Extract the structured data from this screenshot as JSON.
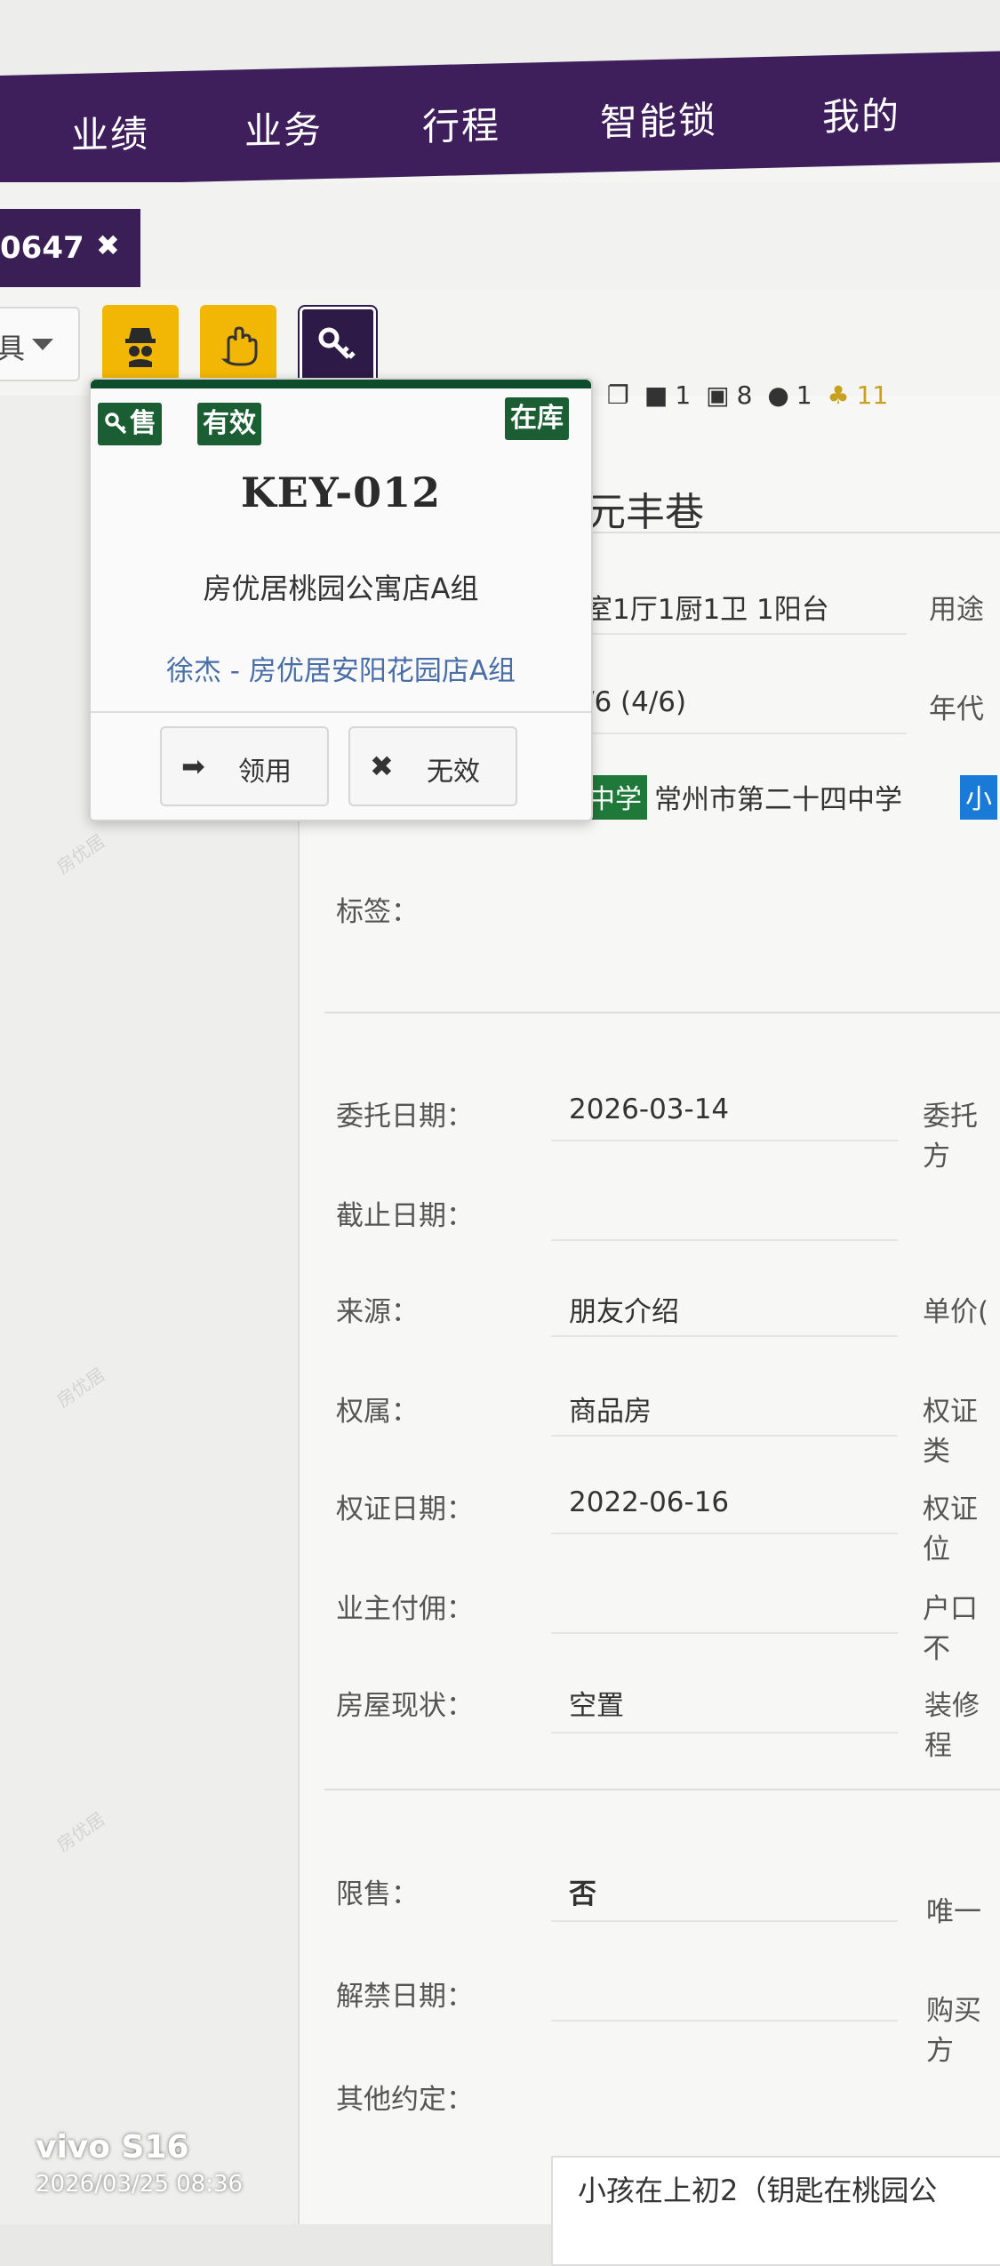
{
  "nav": {
    "items": [
      "业绩",
      "业务",
      "行程",
      "智能锁",
      "我的"
    ]
  },
  "tab": {
    "label": "0647",
    "close": "✖"
  },
  "toolbar": {
    "dropdown_text": "具"
  },
  "icons_row": {
    "video_count": "1",
    "image_count": "8",
    "person_count": "1",
    "gold_count": "11"
  },
  "property": {
    "address_fragment": "元丰巷",
    "layout": "室1厅1厨1卫 1阳台",
    "usage_label": "用途",
    "floor": "/6 (4/6)",
    "year_label": "年代",
    "school_badge": "中学",
    "school_name": "常州市第二十四中学",
    "school_badge2": "小"
  },
  "fields": {
    "tags_label": "标签：",
    "commission_date_label": "委托日期：",
    "commission_date": "2026-03-14",
    "commission_right_label": "委托方",
    "deadline_label": "截止日期：",
    "source_label": "来源：",
    "source_value": "朋友介绍",
    "unit_price_label": "单价(",
    "ownership_label": "权属：",
    "ownership_value": "商品房",
    "cert_type_label": "权证类",
    "cert_date_label": "权证日期：",
    "cert_date": "2022-06-16",
    "cert_right_label": "权证位",
    "owner_commission_label": "业主付佣：",
    "hukou_label": "户口不",
    "status_label": "房屋现状：",
    "status_value": "空置",
    "decor_label": "装修程",
    "restrict_label": "限售：",
    "restrict_value": "否",
    "unique_label": "唯一",
    "release_label": "解禁日期：",
    "purchase_label": "购买方",
    "other_label": "其他约定：",
    "notes": "小孩在上初2（钥匙在桃园公"
  },
  "key_popup": {
    "tag_sale": "售",
    "tag_valid": "有效",
    "tag_instock": "在库",
    "key_code": "KEY-012",
    "store": "房优居桃园公寓店A组",
    "holder": "徐杰 - 房优居安阳花园店A组",
    "borrow_label": "领用",
    "invalid_label": "无效"
  },
  "watermark": {
    "text": "房优居"
  },
  "device": {
    "brand": "vivo S16",
    "timestamp": "2026/03/25 08:36"
  }
}
